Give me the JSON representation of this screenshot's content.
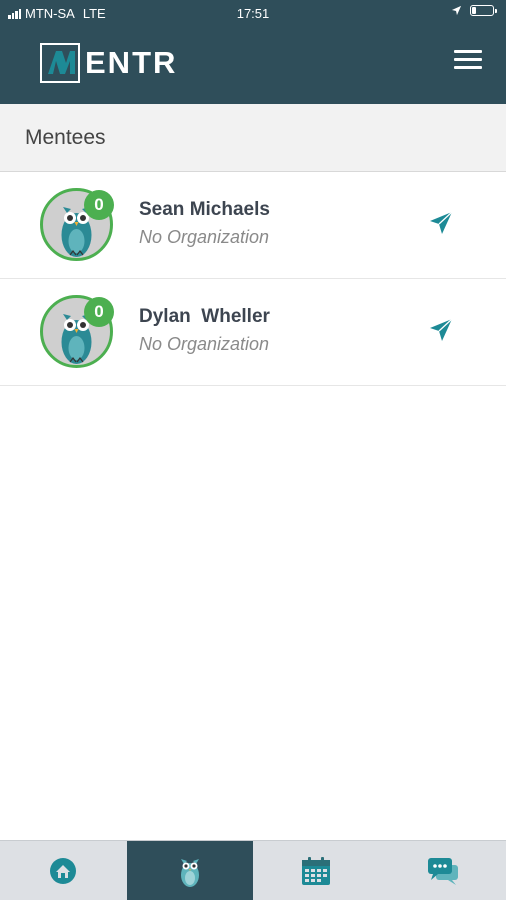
{
  "status_bar": {
    "carrier": "MTN-SA",
    "network": "LTE",
    "time": "17:51"
  },
  "app": {
    "logo_text": "ENTR",
    "logo_letter": "M",
    "brand_color": "#2f4e5a",
    "accent_color": "#4caf50",
    "icon_color": "#1d8a96"
  },
  "header": {
    "menu_icon": "hamburger-menu-icon"
  },
  "section": {
    "title": "Mentees"
  },
  "mentees": [
    {
      "name": "Sean Michaels",
      "organization": "No Organization",
      "badge_count": "0",
      "action_icon": "send-message-icon"
    },
    {
      "name": "Dylan  Wheller",
      "organization": "No Organization",
      "badge_count": "0",
      "action_icon": "send-message-icon"
    }
  ],
  "tabbar": {
    "tabs": [
      {
        "icon": "home-icon",
        "active": false
      },
      {
        "icon": "owl-mentees-icon",
        "active": true
      },
      {
        "icon": "calendar-icon",
        "active": false
      },
      {
        "icon": "chat-icon",
        "active": false
      }
    ]
  }
}
